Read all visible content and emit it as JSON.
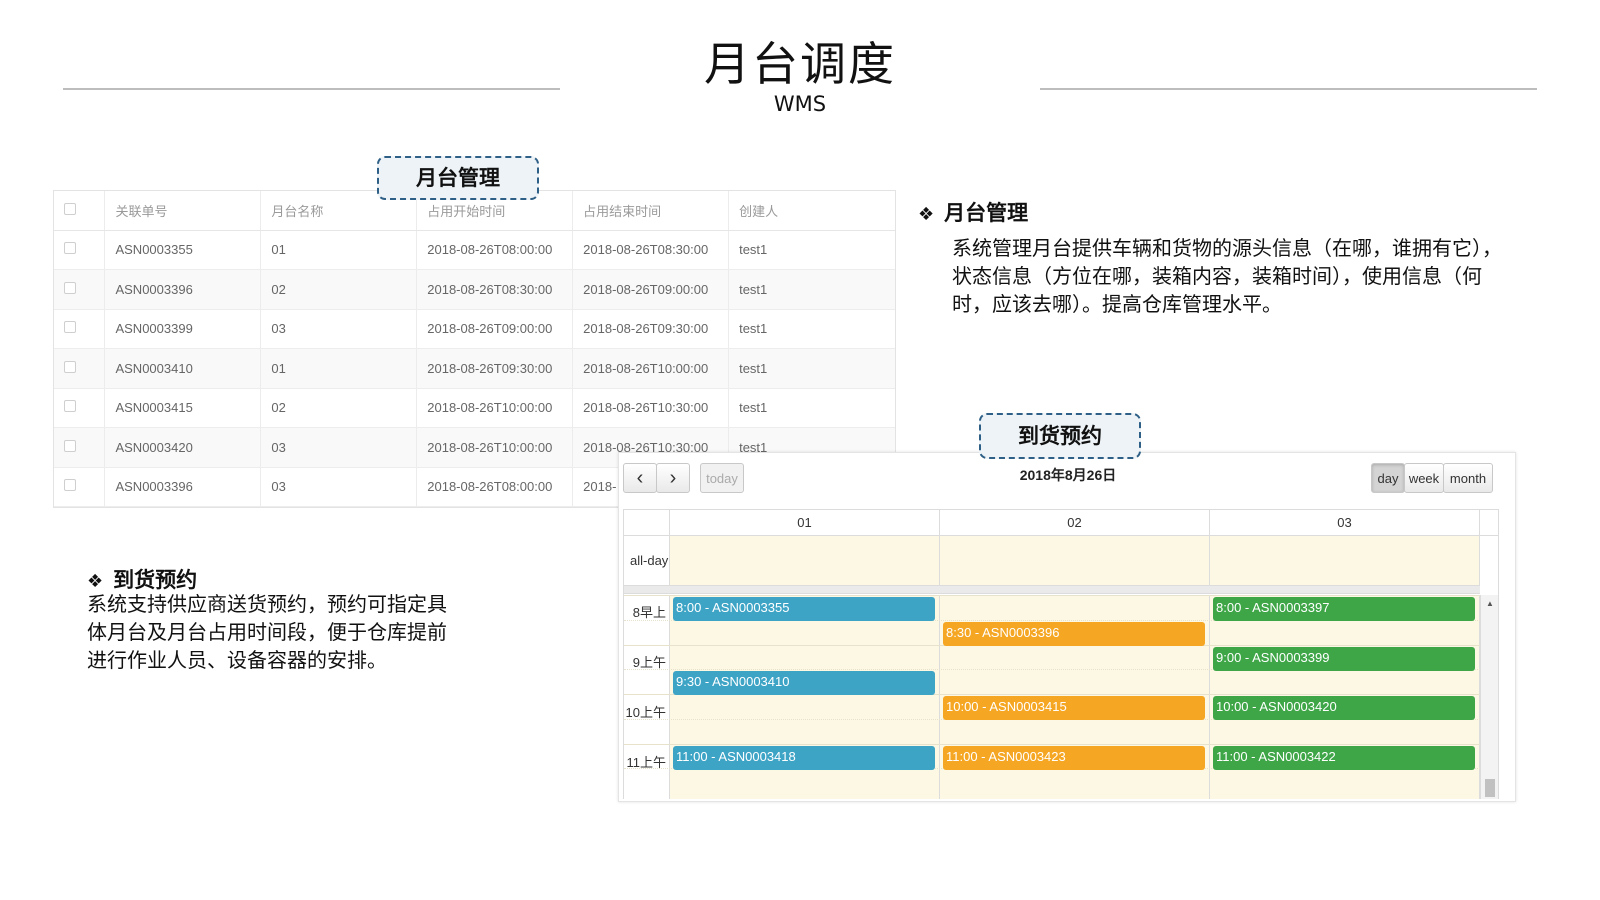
{
  "header": {
    "title": "月台调度",
    "subtitle": "WMS"
  },
  "callouts": {
    "dock_management": "月台管理",
    "arrival_booking": "到货预约"
  },
  "dock_table": {
    "columns": [
      "关联单号",
      "月台名称",
      "占用开始时间",
      "占用结束时间",
      "创建人"
    ],
    "rows": [
      [
        "ASN0003355",
        "01",
        "2018-08-26T08:00:00",
        "2018-08-26T08:30:00",
        "test1"
      ],
      [
        "ASN0003396",
        "02",
        "2018-08-26T08:30:00",
        "2018-08-26T09:00:00",
        "test1"
      ],
      [
        "ASN0003399",
        "03",
        "2018-08-26T09:00:00",
        "2018-08-26T09:30:00",
        "test1"
      ],
      [
        "ASN0003410",
        "01",
        "2018-08-26T09:30:00",
        "2018-08-26T10:00:00",
        "test1"
      ],
      [
        "ASN0003415",
        "02",
        "2018-08-26T10:00:00",
        "2018-08-26T10:30:00",
        "test1"
      ],
      [
        "ASN0003420",
        "03",
        "2018-08-26T10:00:00",
        "2018-08-26T10:30:00",
        "test1"
      ],
      [
        "ASN0003396",
        "03",
        "2018-08-26T08:00:00",
        "2018-",
        ""
      ]
    ]
  },
  "sections": {
    "dock": {
      "heading": "月台管理",
      "lines": [
        "系统管理月台提供车辆和货物的源头信息（在哪，谁拥有它），",
        "状态信息（方位在哪，装箱内容，装箱时间），使用信息（何",
        "时，应该去哪）。提高仓库管理水平。"
      ]
    },
    "booking": {
      "heading": "到货预约",
      "lines": [
        "系统支持供应商送货预约，预约可指定具",
        "体月台及月台占用时间段，便于仓库提前",
        "进行作业人员、设备容器的安排。"
      ]
    }
  },
  "calendar": {
    "date_title": "2018年8月26日",
    "buttons": {
      "prev": "‹",
      "next": "›",
      "today": "today",
      "day": "day",
      "week": "week",
      "month": "month"
    },
    "all_day_label": "all-day",
    "docks": [
      "01",
      "02",
      "03"
    ],
    "time_labels": [
      "8早上",
      "9上午",
      "10上午",
      "11上午"
    ],
    "colors": {
      "dock01": "#3ea4c6",
      "dock02": "#f5a623",
      "dock03": "#3fa648"
    },
    "events": [
      {
        "dock": 0,
        "label": "8:00 - ASN0003355",
        "start": 8.0
      },
      {
        "dock": 1,
        "label": "8:30 - ASN0003396",
        "start": 8.5
      },
      {
        "dock": 2,
        "label": "8:00 - ASN0003397",
        "start": 8.0
      },
      {
        "dock": 2,
        "label": "9:00 - ASN0003399",
        "start": 9.0
      },
      {
        "dock": 0,
        "label": "9:30 - ASN0003410",
        "start": 9.5
      },
      {
        "dock": 1,
        "label": "10:00 - ASN0003415",
        "start": 10.0
      },
      {
        "dock": 2,
        "label": "10:00 - ASN0003420",
        "start": 10.0
      },
      {
        "dock": 0,
        "label": "11:00 - ASN0003418",
        "start": 11.0
      },
      {
        "dock": 1,
        "label": "11:00 - ASN0003423",
        "start": 11.0
      },
      {
        "dock": 2,
        "label": "11:00 - ASN0003422",
        "start": 11.0
      }
    ]
  }
}
